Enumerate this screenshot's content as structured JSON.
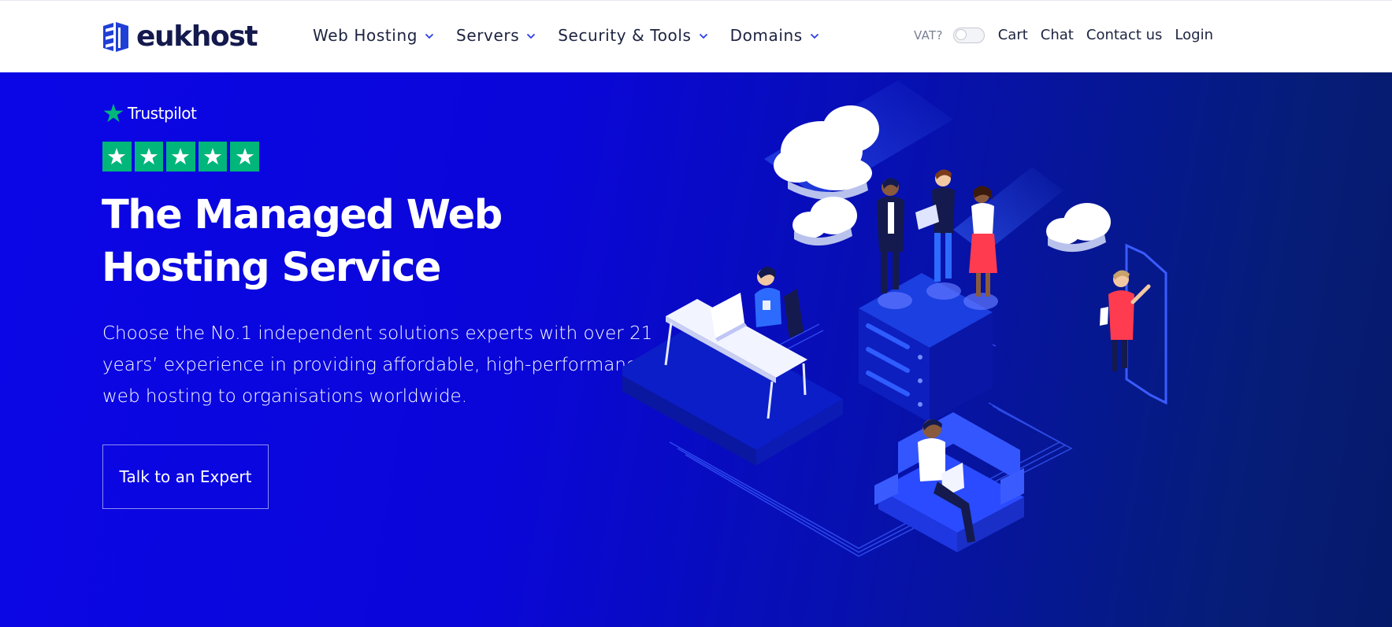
{
  "brand": {
    "name": "eukhost"
  },
  "nav": [
    {
      "label": "Web Hosting"
    },
    {
      "label": "Servers"
    },
    {
      "label": "Security & Tools"
    },
    {
      "label": "Domains"
    }
  ],
  "utility": {
    "vat_label": "VAT?",
    "vat_enabled": false,
    "links": [
      "Cart",
      "Chat",
      "Contact us",
      "Login"
    ]
  },
  "hero": {
    "trustpilot_label": "Trustpilot",
    "rating_stars": 5,
    "title_line1": "The Managed Web",
    "title_line2": "Hosting Service",
    "description": "Choose the No.1 independent solutions experts with over 21 years’ experience in providing affordable, high-performance web hosting to organisations worldwide.",
    "cta_label": "Talk to an Expert"
  },
  "colors": {
    "brand_navy": "#141a4d",
    "hero_blue": "#0b06e6",
    "trustpilot_green": "#00b67a",
    "text_white": "#ffffff"
  }
}
